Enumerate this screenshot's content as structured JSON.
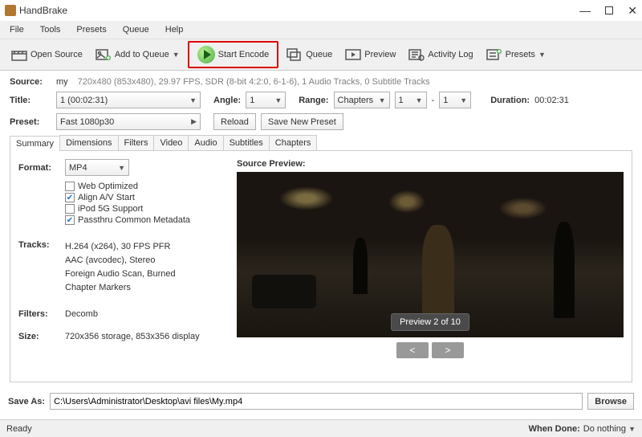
{
  "window": {
    "title": "HandBrake"
  },
  "menu": {
    "file": "File",
    "tools": "Tools",
    "presets": "Presets",
    "queue": "Queue",
    "help": "Help"
  },
  "toolbar": {
    "openSource": "Open Source",
    "addToQueue": "Add to Queue",
    "startEncode": "Start Encode",
    "queue": "Queue",
    "preview": "Preview",
    "activityLog": "Activity Log",
    "presets": "Presets"
  },
  "source": {
    "label": "Source:",
    "name": "my",
    "info": "720x480 (853x480), 29.97 FPS, SDR (8-bit 4:2:0, 6-1-6), 1 Audio Tracks, 0 Subtitle Tracks"
  },
  "title": {
    "label": "Title:",
    "value": "1 (00:02:31)"
  },
  "angle": {
    "label": "Angle:",
    "value": "1"
  },
  "range": {
    "label": "Range:",
    "type": "Chapters",
    "from": "1",
    "to": "1",
    "dash": "-"
  },
  "duration": {
    "label": "Duration:",
    "value": "00:02:31"
  },
  "preset": {
    "label": "Preset:",
    "value": "Fast 1080p30",
    "reload": "Reload",
    "saveNew": "Save New Preset"
  },
  "tabs": {
    "summary": "Summary",
    "dimensions": "Dimensions",
    "filters": "Filters",
    "video": "Video",
    "audio": "Audio",
    "subtitles": "Subtitles",
    "chapters": "Chapters"
  },
  "summary": {
    "formatLabel": "Format:",
    "formatValue": "MP4",
    "webOptimized": "Web Optimized",
    "alignAV": "Align A/V Start",
    "ipod5g": "iPod 5G Support",
    "passthru": "Passthru Common Metadata",
    "tracksLabel": "Tracks:",
    "track1": "H.264 (x264), 30 FPS PFR",
    "track2": "AAC (avcodec), Stereo",
    "track3": "Foreign Audio Scan, Burned",
    "track4": "Chapter Markers",
    "filtersLabel": "Filters:",
    "filtersValue": "Decomb",
    "sizeLabel": "Size:",
    "sizeValue": "720x356 storage, 853x356 display"
  },
  "preview": {
    "heading": "Source Preview:",
    "badge": "Preview 2 of 10",
    "prev": "<",
    "next": ">"
  },
  "save": {
    "label": "Save As:",
    "path": "C:\\Users\\Administrator\\Desktop\\avi files\\My.mp4",
    "browse": "Browse"
  },
  "status": {
    "ready": "Ready",
    "whenDoneLabel": "When Done:",
    "whenDoneValue": "Do nothing"
  }
}
